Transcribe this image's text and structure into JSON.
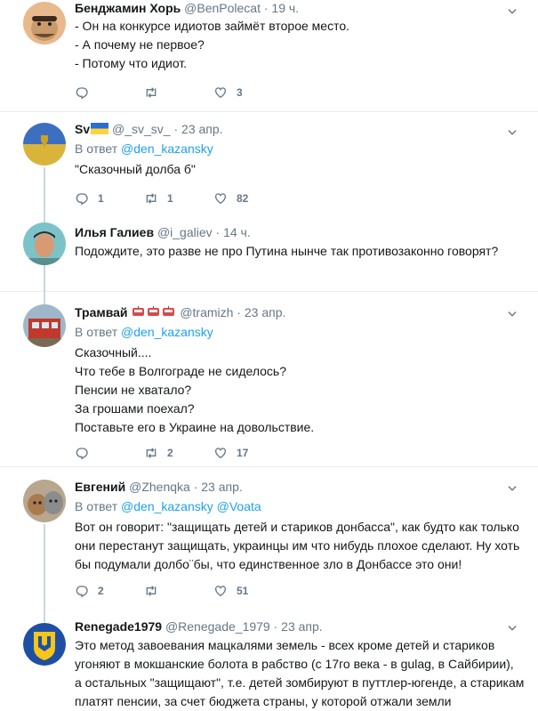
{
  "tweets": [
    {
      "name": "Бенджамин Хорь",
      "handle": "@BenPolecat",
      "time": "· 19 ч.",
      "lines": [
        "- Он на конкурсе идиотов займёт второе место.",
        "- А почему не первое?",
        "- Потому что идиот."
      ],
      "replies": "",
      "retweets": "",
      "likes": "3"
    },
    {
      "name": "Sv",
      "handle": "@_sv_sv_",
      "time": "· 23 апр.",
      "reply_prefix": "В ответ",
      "reply_mention": "@den_kazansky",
      "lines": [
        "\"Сказочный долба  б\""
      ],
      "replies": "1",
      "retweets": "1",
      "likes": "82"
    },
    {
      "name": "Илья Галиев",
      "handle": "@i_galiev",
      "time": "· 14 ч.",
      "lines": [
        "Подождите, это разве не про Путина нынче так противозаконно говорят?"
      ],
      "replies": "",
      "retweets": "",
      "likes": ""
    },
    {
      "name": "Трамвай",
      "handle": "@tramizh",
      "time": "· 23 апр.",
      "reply_prefix": "В ответ",
      "reply_mention": "@den_kazansky",
      "lines": [
        "Сказочный....",
        "Что тебе в Волгограде не сиделось?",
        "Пенсии не хватало?",
        "За грошами поехал?",
        "Поставьте его в Украине на довольствие."
      ],
      "replies": "",
      "retweets": "2",
      "likes": "17"
    },
    {
      "name": "Евгений",
      "handle": "@Zhenqka",
      "time": "· 23 апр.",
      "reply_prefix": "В ответ",
      "reply_mention": "@den_kazansky @Voata",
      "lines": [
        "Вот он говорит: \"защищать детей и стариков донбасса\", как будто как только",
        "они перестанут защищать, украинцы им что нибудь плохое сделают. Ну хоть",
        "бы подумали долбо¨бы, что единственное зло в Донбассе это они!"
      ],
      "replies": "2",
      "retweets": "",
      "likes": "51"
    },
    {
      "name": "Renegade1979",
      "handle": "@Renegade_1979",
      "time": "· 23 апр.",
      "lines": [
        "Это метод завоевания мацкалями земель - всех кроме детей и стариков",
        "угоняют в мокшанские болота в рабство (с 17го века - в gulag, в Сайбирии),",
        "а остальных \"защищают\", т.е. детей зомбируют в путтлер-югенде, а старикам",
        "платят пенсии, за счет бюджета страны, у которой отжали земли"
      ]
    }
  ],
  "colors": {
    "link": "#1da1f2",
    "muted": "#657786",
    "border": "#e6ecf0"
  }
}
